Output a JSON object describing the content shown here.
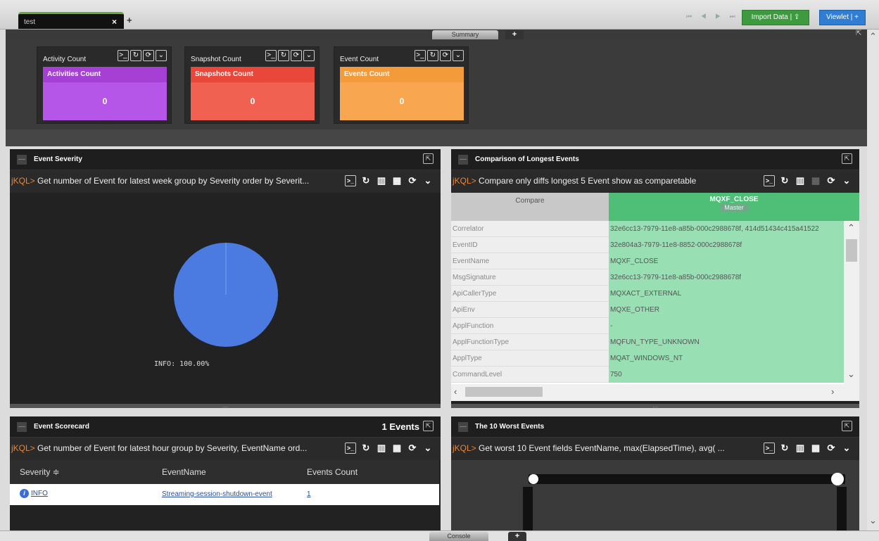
{
  "top": {
    "tab_label": "test",
    "tab_close": "×",
    "tab_add": "+",
    "nav_arrows": "⏮ ◀ ▶ ⏭",
    "import_btn": "Import Data | ⇪",
    "viewlet_btn": "Viewlet | +"
  },
  "summary": {
    "tab_label": "Summary",
    "add": "+",
    "cards": [
      {
        "title": "Activity Count",
        "head": "Activities Count",
        "value": "0",
        "color_head": "#a63fd4",
        "color_body": "#b556e8"
      },
      {
        "title": "Snapshot Count",
        "head": "Snapshots Count",
        "value": "0",
        "color_head": "#e8473a",
        "color_body": "#f06152"
      },
      {
        "title": "Event Count",
        "head": "Events Count",
        "value": "0",
        "color_head": "#f39a3a",
        "color_body": "#f8a64f"
      }
    ]
  },
  "icons": {
    "console": ">_",
    "refresh": "↻",
    "reload": "⟳",
    "chevron": "⌄",
    "chart": "▥",
    "calendar": "▦",
    "popout": "⇱"
  },
  "severity_panel": {
    "title": "Event Severity",
    "query_kw": "jKQL>",
    "query": " Get number of Event for latest week group by Severity order by Severit...",
    "pie_label": "INFO: 100.00%",
    "pie_value": 100,
    "pie_color": "#4b7be0"
  },
  "compare_panel": {
    "title": "Comparison of Longest Events",
    "query_kw": "jKQL>",
    "query": " Compare only diffs longest 5 Event show as comparetable",
    "col_left": "Compare",
    "col_right": "MQXF_CLOSE",
    "col_right_sub": "Master",
    "rows": [
      {
        "k": "Correlator",
        "v": "32e6cc13-7979-11e8-a85b-000c2988678f, 414d51434c415a41522"
      },
      {
        "k": "EventID",
        "v": "32e804a3-7979-11e8-8852-000c2988678f"
      },
      {
        "k": "EventName",
        "v": "MQXF_CLOSE"
      },
      {
        "k": "MsgSignature",
        "v": "32e6cc13-7979-11e8-a85b-000c2988678f"
      },
      {
        "k": "ApiCallerType",
        "v": "MQXACT_EXTERNAL"
      },
      {
        "k": "ApiEnv",
        "v": "MQXE_OTHER"
      },
      {
        "k": "ApplFunction",
        "v": "-"
      },
      {
        "k": "ApplFunctionType",
        "v": "MQFUN_TYPE_UNKNOWN"
      },
      {
        "k": "ApplType",
        "v": "MQAT_WINDOWS_NT"
      },
      {
        "k": "CommandLevel",
        "v": "750"
      }
    ]
  },
  "scorecard_panel": {
    "title": "Event Scorecard",
    "count": "1 Events",
    "query_kw": "jKQL>",
    "query": " Get number of Event for latest hour group by Severity, EventName ord...",
    "headers": [
      "Severity ≑",
      "EventName",
      "Events Count"
    ],
    "row": {
      "severity": "INFO",
      "event_name": "Streaming-session-shutdown-event",
      "count": "1"
    }
  },
  "worst_panel": {
    "title": "The 10 Worst Events",
    "query_kw": "jKQL>",
    "query": " Get worst 10 Event fields EventName, max(ElapsedTime), avg( ..."
  },
  "bottom": {
    "console_label": "Console",
    "add": "+"
  }
}
